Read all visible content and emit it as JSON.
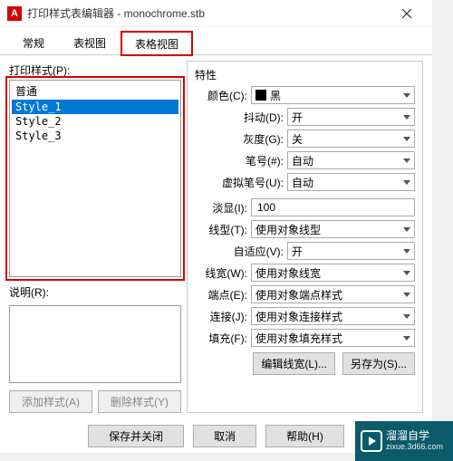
{
  "window": {
    "title": "打印样式表编辑器 - monochrome.stb"
  },
  "tabs": {
    "items": [
      "常规",
      "表视图",
      "表格视图"
    ],
    "active": 2
  },
  "left": {
    "listLabel": "打印样式(P):",
    "items": [
      "普通",
      "Style_1",
      "Style_2",
      "Style_3"
    ],
    "selected": 1,
    "descLabel": "说明(R):",
    "descText": "",
    "addBtn": "添加样式(A)",
    "delBtn": "删除样式(Y)"
  },
  "props": {
    "header": "特性",
    "color": {
      "label": "颜色(C):",
      "value": "黑"
    },
    "dither": {
      "label": "抖动(D):",
      "value": "开"
    },
    "gray": {
      "label": "灰度(G):",
      "value": "关"
    },
    "pen": {
      "label": "笔号(#):",
      "value": "自动"
    },
    "vpen": {
      "label": "虚拟笔号(U):",
      "value": "自动"
    },
    "screen": {
      "label": "淡显(I):",
      "value": "100"
    },
    "ltype": {
      "label": "线型(T):",
      "value": "使用对象线型"
    },
    "adaptive": {
      "label": "自适应(V):",
      "value": "开"
    },
    "lweight": {
      "label": "线宽(W):",
      "value": "使用对象线宽"
    },
    "endcap": {
      "label": "端点(E):",
      "value": "使用对象端点样式"
    },
    "join": {
      "label": "连接(J):",
      "value": "使用对象连接样式"
    },
    "fill": {
      "label": "填充(F):",
      "value": "使用对象填充样式"
    },
    "editLw": "编辑线宽(L)...",
    "saveAs": "另存为(S)..."
  },
  "bottom": {
    "saveClose": "保存并关闭",
    "cancel": "取消",
    "help": "帮助(H)"
  },
  "watermark": {
    "line1": "溜溜自学",
    "line2": "zixue.3d66.com"
  }
}
